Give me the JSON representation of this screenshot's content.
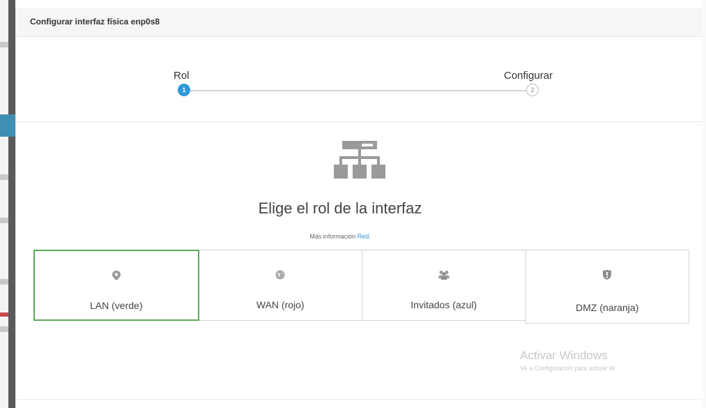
{
  "modal": {
    "title": "Configurar interfaz física enp0s8"
  },
  "wizard": {
    "steps": [
      {
        "label": "Rol",
        "number": "1",
        "state": "active"
      },
      {
        "label": "Configurar",
        "number": "2",
        "state": "pending"
      }
    ]
  },
  "main": {
    "heading": "Elige el rol de la interfaz",
    "info_text": "Más información",
    "info_link": "Red."
  },
  "roles": [
    {
      "label": "LAN (verde)",
      "icon": "map-marker-icon",
      "selected": true
    },
    {
      "label": "WAN (rojo)",
      "icon": "globe-icon",
      "selected": false
    },
    {
      "label": "Invitados (azul)",
      "icon": "users-icon",
      "selected": false
    },
    {
      "label": "DMZ (naranja)",
      "icon": "shield-icon",
      "selected": false
    }
  ],
  "watermark": {
    "title": "Activar Windows",
    "subtitle": "Ve a Configuración para activar W"
  },
  "colors": {
    "accent": "#2f9ad9",
    "selected_border": "#5aa85a",
    "link": "#2f8fd0"
  }
}
